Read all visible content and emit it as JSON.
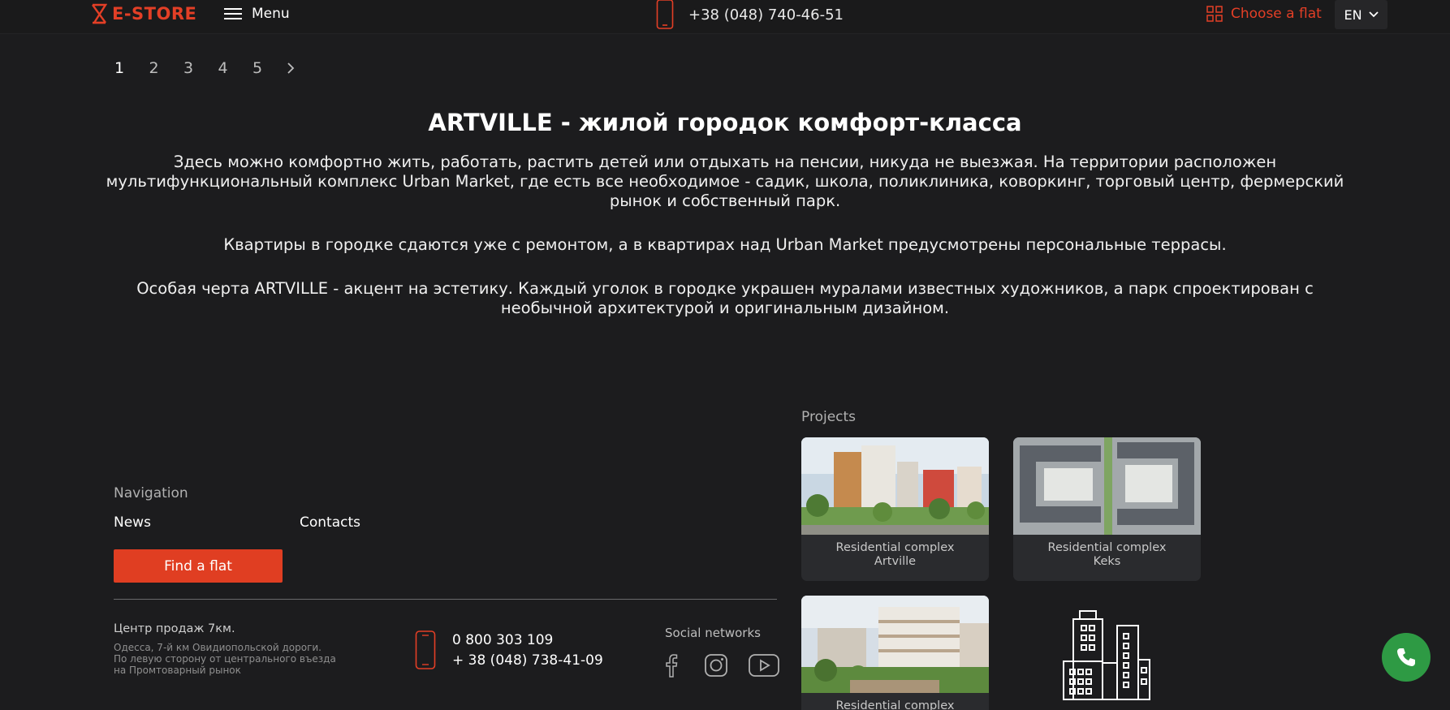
{
  "header": {
    "logo_text": "E-STORE",
    "menu_label": "Menu",
    "phone": "+38 (048) 740-46-51",
    "choose_flat_label": "Choose a flat",
    "language": "EN",
    "accent_color": "#e33f26"
  },
  "pagination": {
    "pages": [
      "1",
      "2",
      "3",
      "4",
      "5"
    ],
    "current": "1"
  },
  "article": {
    "title": "ARTVILLE - жилой городок комфорт-класса",
    "paragraph_1": "Здесь можно комфортно жить, работать, растить детей или отдыхать на пенсии, никуда не выезжая. На территории расположен мультифункциональный комплекс Urban Market, где есть все необходимое - садик, школа, поликлиника, коворкинг, торговый центр, фермерский рынок и собственный парк.",
    "paragraph_2": "Квартиры в городке сдаются уже с ремонтом, а в квартирах над Urban Market предусмотрены персональные террасы.",
    "paragraph_3": "Особая черта ARTVILLE - акцент на эстетику. Каждый уголок в городке украшен муралами известных художников, а парк спроектирован с необычной архитектурой и оригинальным дизайном."
  },
  "footer": {
    "navigation_label": "Navigation",
    "nav_links": [
      "News",
      "Contacts"
    ],
    "find_button": "Find a flat",
    "sales_title": "Центр продаж 7км.",
    "sales_address_lines": [
      "Одесса, 7-й км Овидиопольской дороги.",
      "По левую сторону от центрального въезда",
      "на Промтоварный рынок"
    ],
    "phones": [
      "0 800 303 109",
      "+ 38 (048) 738-41-09"
    ],
    "social_label": "Social networks",
    "social_icons": [
      "facebook-icon",
      "instagram-icon",
      "youtube-icon"
    ],
    "projects_label": "Projects",
    "projects": [
      {
        "name_line_1": "Residential complex",
        "name_line_2": "Artville"
      },
      {
        "name_line_1": "Residential complex",
        "name_line_2": "Keks"
      },
      {
        "name_line_1": "Residential complex",
        "name_line_2": ""
      }
    ],
    "call_button_color": "#2e9a44"
  }
}
